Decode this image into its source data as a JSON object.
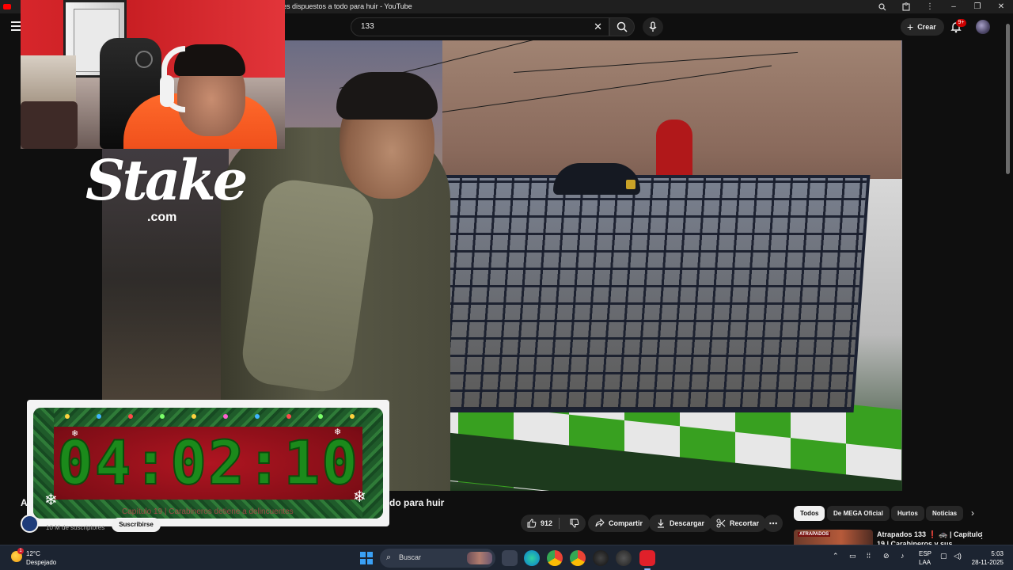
{
  "browser": {
    "tab_title": "es dispuestos a todo para huir - YouTube",
    "controls": {
      "extensions_icon": "puzzle-icon",
      "minimize": "–",
      "restore": "❐",
      "close": "✕"
    }
  },
  "youtube": {
    "search_value": "133",
    "create_label": "Crear",
    "notifications_badge": "9+"
  },
  "overlays": {
    "stake_word": "Stake",
    "stake_domain": ".com",
    "timer": "04:02:10",
    "timer_subtitle": "Capítulo 19 | Carabineros detiene a delincuentes"
  },
  "video_meta": {
    "title_start": "A",
    "title_end": "do para huir",
    "subscribers": "10 M de suscriptores",
    "subscribe_label": "Suscribirse",
    "likes": "912",
    "share_label": "Compartir",
    "download_label": "Descargar",
    "clip_label": "Recortar",
    "more_label": "⋯"
  },
  "related": {
    "chips": [
      "Todos",
      "De MEGA Oficial",
      "Hurtos",
      "Noticias"
    ],
    "first_video": {
      "thumb_tag": "ATRAPADOS",
      "title_line1": "Atrapados 133 ❗ 🚓 | Capítulo",
      "title_line2": "19 | Carabineros y sus"
    }
  },
  "taskbar": {
    "temperature": "12°C",
    "condition": "Despejado",
    "weather_badge": "1",
    "search_label": "Buscar",
    "lang_line1": "ESP",
    "lang_line2": "LAA",
    "time": "5:03",
    "date": "28-11-2025"
  },
  "colors": {
    "youtube_red": "#ff0000",
    "timer_green": "#1b8a1b",
    "taskbar_bg": "#1c2431"
  }
}
